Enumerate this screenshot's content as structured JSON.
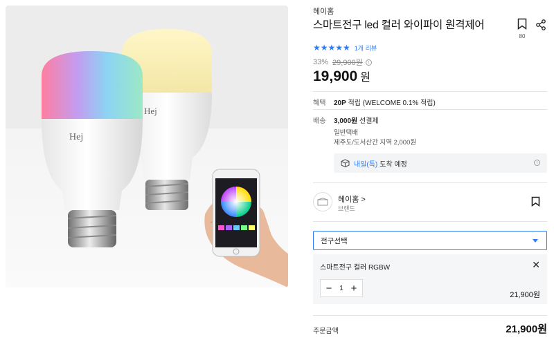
{
  "product": {
    "brand": "헤이홈",
    "title": "스마트전구 led 컬러 와이파이 원격제어",
    "bookmark_count": "80",
    "review_link": "1개 리뷰",
    "discount": "33%",
    "original_price": "29,900원",
    "final_price": "19,900",
    "currency": "원",
    "rating_stars": 5
  },
  "benefit": {
    "label": "혜택",
    "value_bold": "20P",
    "value_rest": " 적립 (WELCOME 0.1% 적립)"
  },
  "shipping": {
    "label": "배송",
    "fee": "3,000원",
    "fee_suffix": " 선결제",
    "type": "일반택배",
    "extra": "제주도/도서산간 지역 2,000원",
    "arrival_highlight": "내일(특)",
    "arrival_rest": "도착 예정"
  },
  "store": {
    "name": "헤이홈 >",
    "sub": "브랜드"
  },
  "option_select": {
    "placeholder": "전구선택"
  },
  "selected_option": {
    "name": "스마트전구 컬러 RGBW",
    "quantity": "1",
    "price": "21,900원"
  },
  "order": {
    "label": "주문금액",
    "total": "21,900원"
  },
  "colors": {
    "accent": "#2e7cf6"
  },
  "icons": {
    "bookmark": "bookmark-icon",
    "share": "share-icon",
    "info": "info-icon",
    "delivery": "delivery-icon",
    "close": "close-icon",
    "minus": "minus-icon",
    "plus": "plus-icon",
    "caret": "chevron-down-icon"
  },
  "image_text": {
    "bulb_logo": "Hej"
  }
}
